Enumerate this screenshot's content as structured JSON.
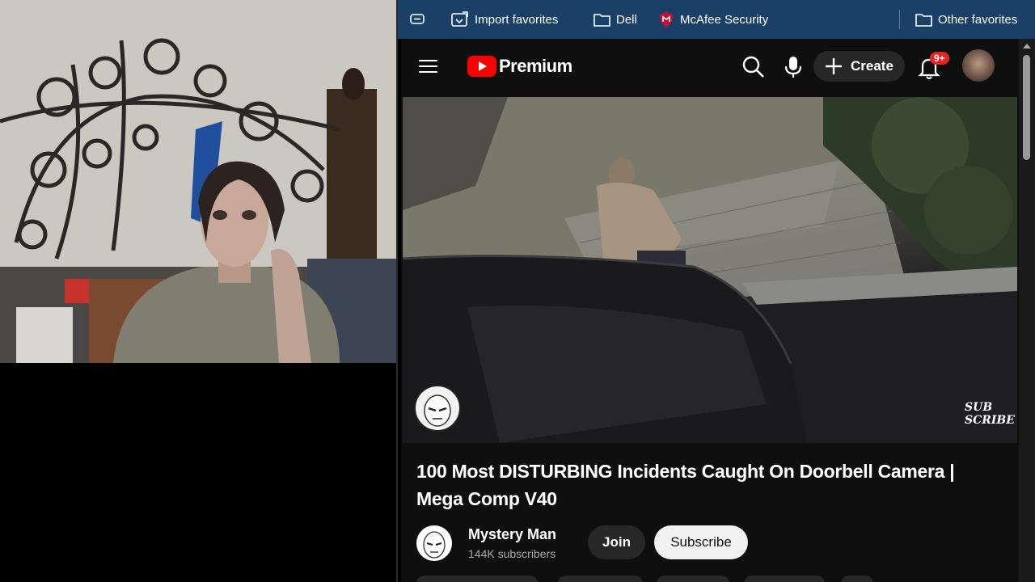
{
  "favorites_bar": {
    "items": [
      {
        "label": "",
        "icon": "collections-icon"
      },
      {
        "label": "Import favorites",
        "icon": "import-favorites-icon"
      },
      {
        "label": "Dell",
        "icon": "folder-icon"
      },
      {
        "label": "McAfee Security",
        "icon": "mcafee-shield-icon"
      }
    ],
    "other_favorites": {
      "label": "Other favorites",
      "icon": "folder-icon"
    },
    "background_color": "#1b4068"
  },
  "youtube": {
    "logo_text": "Premium",
    "logo_color": "#ff0000",
    "create_label": "Create",
    "notification_badge": "9+",
    "video": {
      "title": "100 Most DISTURBING Incidents Caught On Doorbell Camera | Mega Comp V40",
      "watermark_text": "SUB SCRIBE"
    },
    "channel": {
      "name": "Mystery Man",
      "subscribers": "144K subscribers"
    },
    "join_label": "Join",
    "subscribe_label": "Subscribe"
  }
}
